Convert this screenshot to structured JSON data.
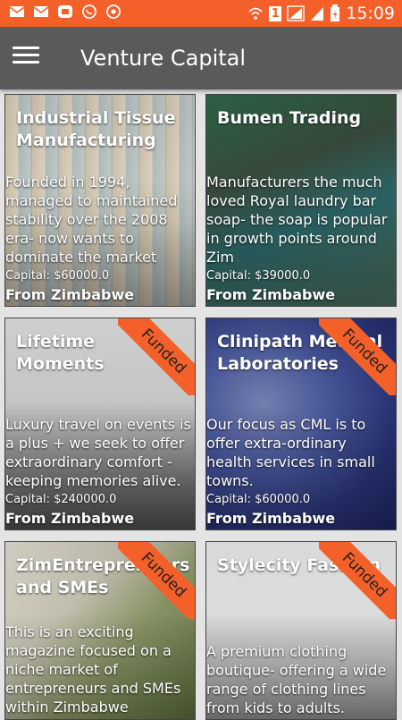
{
  "status_bar": {
    "time": "15:09",
    "battery_indicator": "1"
  },
  "app_bar": {
    "title": "Venture Capital"
  },
  "cards": [
    {
      "title": "Industrial Tissue Manufacturing",
      "description": "Founded in 1994, managed to maintained stability over the 2008 era- now wants to dominate the market",
      "capital": "Capital: $60000.0",
      "from": "From Zimbabwe",
      "funded": false
    },
    {
      "title": "Bumen Trading",
      "description": "Manufacturers the much loved Royal laundry bar soap- the soap is popular in growth points around Zim",
      "capital": "Capital: $39000.0",
      "from": "From Zimbabwe",
      "funded": false
    },
    {
      "title": "Lifetime Moments",
      "description": "Luxury travel on events is a plus + we seek to offer extraordinary comfort - keeping memories alive.",
      "capital": "Capital: $240000.0",
      "from": "From Zimbabwe",
      "funded": true,
      "ribbon": "Funded"
    },
    {
      "title": "Clinipath Medical Laboratories",
      "description": "Our focus as CML is to offer extra-ordinary health services in small towns.",
      "capital": "Capital: $60000.0",
      "from": "From Zimbabwe",
      "funded": true,
      "ribbon": "Funded"
    },
    {
      "title": "ZimEntrepreneurs and SMEs",
      "description": "This is an exciting magazine focused on a niche market of entrepreneurs and SMEs within Zimbabwe",
      "capital": "",
      "from": "",
      "funded": true,
      "ribbon": "Funded"
    },
    {
      "title": "Stylecity Fashion",
      "description": "A premium clothing boutique- offering a wide range of clothing lines from kids to adults.",
      "capital": "",
      "from": "",
      "funded": true,
      "ribbon": "Funded"
    }
  ],
  "colors": {
    "accent": "#f4602a",
    "app_bar": "#5a5a5a"
  }
}
